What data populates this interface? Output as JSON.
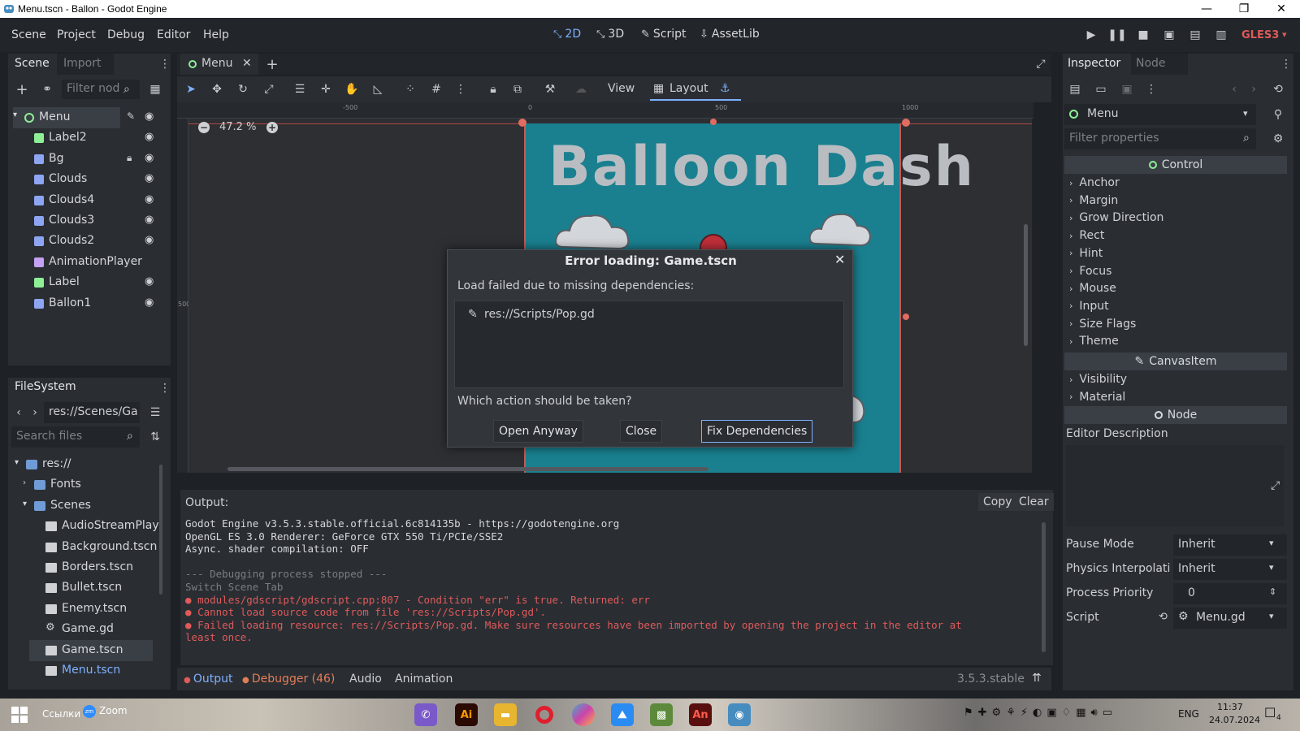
{
  "window": {
    "title": "Menu.tscn - Ballon - Godot Engine",
    "minimize": "—",
    "maximize": "❐",
    "close": "✕"
  },
  "menubar": {
    "items": [
      "Scene",
      "Project",
      "Debug",
      "Editor",
      "Help"
    ],
    "workspaces": [
      "2D",
      "3D",
      "Script",
      "AssetLib"
    ],
    "renderer": "GLES3"
  },
  "scene_dock": {
    "tabs": [
      "Scene",
      "Import"
    ],
    "filter_placeholder": "Filter nod",
    "nodes": [
      {
        "name": "Menu",
        "icon": "control-icon",
        "color": "#8eef97"
      },
      {
        "name": "Label2",
        "icon": "label-icon",
        "color": "#8eef97"
      },
      {
        "name": "Bg",
        "icon": "texture-rect-icon",
        "color": "#8da5f3"
      },
      {
        "name": "Clouds",
        "icon": "texture-rect-icon",
        "color": "#8da5f3"
      },
      {
        "name": "Clouds4",
        "icon": "texture-rect-icon",
        "color": "#8da5f3"
      },
      {
        "name": "Clouds3",
        "icon": "texture-rect-icon",
        "color": "#8da5f3"
      },
      {
        "name": "Clouds2",
        "icon": "texture-rect-icon",
        "color": "#8da5f3"
      },
      {
        "name": "AnimationPlayer",
        "icon": "animation-player-icon",
        "color": "#c4a1f2"
      },
      {
        "name": "Label",
        "icon": "label-icon",
        "color": "#8eef97"
      },
      {
        "name": "Ballon1",
        "icon": "texture-rect-icon",
        "color": "#8da5f3"
      }
    ]
  },
  "filesystem": {
    "title": "FileSystem",
    "path": "res://Scenes/Ga",
    "search_placeholder": "Search files",
    "items": [
      {
        "name": "res://",
        "type": "folder"
      },
      {
        "name": "Fonts",
        "type": "folder"
      },
      {
        "name": "Scenes",
        "type": "folder"
      },
      {
        "name": "AudioStreamPlay",
        "type": "scene"
      },
      {
        "name": "Background.tscn",
        "type": "scene"
      },
      {
        "name": "Borders.tscn",
        "type": "scene"
      },
      {
        "name": "Bullet.tscn",
        "type": "scene"
      },
      {
        "name": "Enemy.tscn",
        "type": "scene"
      },
      {
        "name": "Game.gd",
        "type": "script"
      },
      {
        "name": "Game.tscn",
        "type": "scene"
      },
      {
        "name": "Menu.tscn",
        "type": "scene"
      }
    ]
  },
  "editor": {
    "scene_tab": "Menu",
    "toolbar": {
      "view": "View",
      "layout": "Layout"
    },
    "zoom": "47.2 %",
    "ruler": [
      "-500",
      "0",
      "500",
      "1000"
    ],
    "ruler_v": "500",
    "game_title": "Balloon Dash"
  },
  "dialog": {
    "title": "Error loading: Game.tscn",
    "message": "Load failed due to missing dependencies:",
    "dependency": "res://Scripts/Pop.gd",
    "question": "Which action should be taken?",
    "buttons": [
      "Open Anyway",
      "Close",
      "Fix Dependencies"
    ]
  },
  "output": {
    "label": "Output:",
    "copy": "Copy",
    "clear": "Clear",
    "lines": [
      {
        "text": "Godot Engine v3.5.3.stable.official.6c814135b - https://godotengine.org",
        "kind": "normal"
      },
      {
        "text": "OpenGL ES 3.0 Renderer: GeForce GTX 550 Ti/PCIe/SSE2",
        "kind": "normal"
      },
      {
        "text": "Async. shader compilation: OFF",
        "kind": "normal"
      },
      {
        "text": "",
        "kind": "normal"
      },
      {
        "text": "--- Debugging process stopped ---",
        "kind": "dim"
      },
      {
        "text": "Switch Scene Tab",
        "kind": "dim"
      },
      {
        "text": "modules/gdscript/gdscript.cpp:807 - Condition \"err\" is true. Returned: err",
        "kind": "error"
      },
      {
        "text": "Cannot load source code from file 'res://Scripts/Pop.gd'.",
        "kind": "error"
      },
      {
        "text": "Failed loading resource: res://Scripts/Pop.gd. Make sure resources have been imported by opening the project in the editor at",
        "kind": "error"
      },
      {
        "text": "least once.",
        "kind": "error-cont"
      }
    ],
    "bottom_tabs": [
      "Output",
      "Debugger (46)",
      "Audio",
      "Animation"
    ],
    "version": "3.5.3.stable"
  },
  "inspector": {
    "tabs": [
      "Inspector",
      "Node"
    ],
    "object": "Menu",
    "filter_placeholder": "Filter properties",
    "sections": {
      "control": "Control",
      "control_items": [
        "Anchor",
        "Margin",
        "Grow Direction",
        "Rect",
        "Hint",
        "Focus",
        "Mouse",
        "Input",
        "Size Flags",
        "Theme"
      ],
      "canvas_item": "CanvasItem",
      "canvas_items": [
        "Visibility",
        "Material"
      ],
      "node": "Node"
    },
    "editor_description": "Editor Description",
    "props": [
      {
        "label": "Pause Mode",
        "value": "Inherit"
      },
      {
        "label": "Physics Interpolati",
        "value": "Inherit"
      },
      {
        "label": "Process Priority",
        "value": "0"
      },
      {
        "label": "Script",
        "value": "Menu.gd"
      }
    ]
  },
  "taskbar": {
    "links": "Ссылки",
    "zoom": "Zoom",
    "lang": "ENG",
    "time": "11:37",
    "date": "24.07.2024",
    "notifications": "4"
  }
}
